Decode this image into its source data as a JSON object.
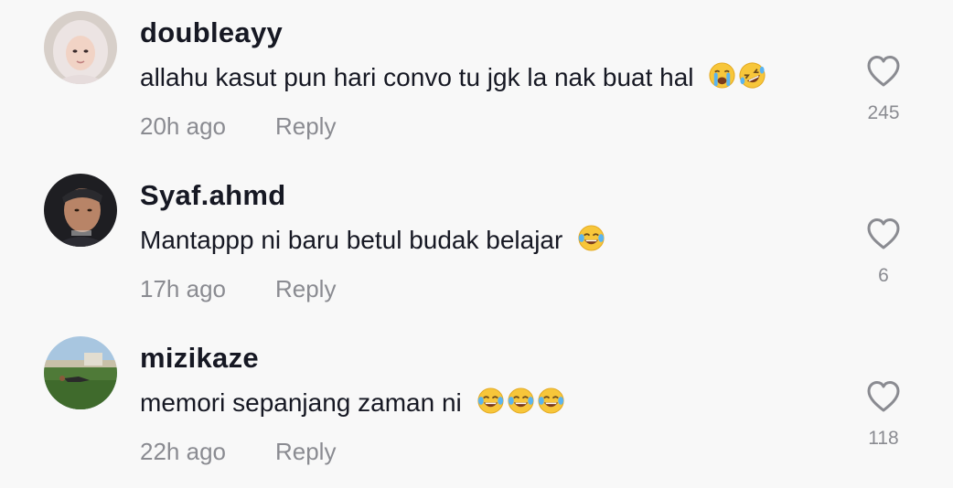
{
  "comments": [
    {
      "username": "doubleayy",
      "text": "allahu kasut pun hari convo tu jgk la nak buat hal",
      "emojis": [
        "loudly-crying-face",
        "rolling-on-floor-laughing"
      ],
      "time": "20h ago",
      "reply_label": "Reply",
      "likes": "245"
    },
    {
      "username": "Syaf.ahmd",
      "text": "Mantappp ni baru betul budak belajar",
      "emojis": [
        "face-with-tears-of-joy"
      ],
      "time": "17h ago",
      "reply_label": "Reply",
      "likes": "6"
    },
    {
      "username": "mizikaze",
      "text": "memori sepanjang zaman ni",
      "emojis": [
        "face-with-tears-of-joy",
        "face-with-tears-of-joy",
        "face-with-tears-of-joy"
      ],
      "time": "22h ago",
      "reply_label": "Reply",
      "likes": "118"
    }
  ],
  "colors": {
    "background": "#f8f8f8",
    "text": "#161823",
    "secondary": "#8a8b91"
  }
}
